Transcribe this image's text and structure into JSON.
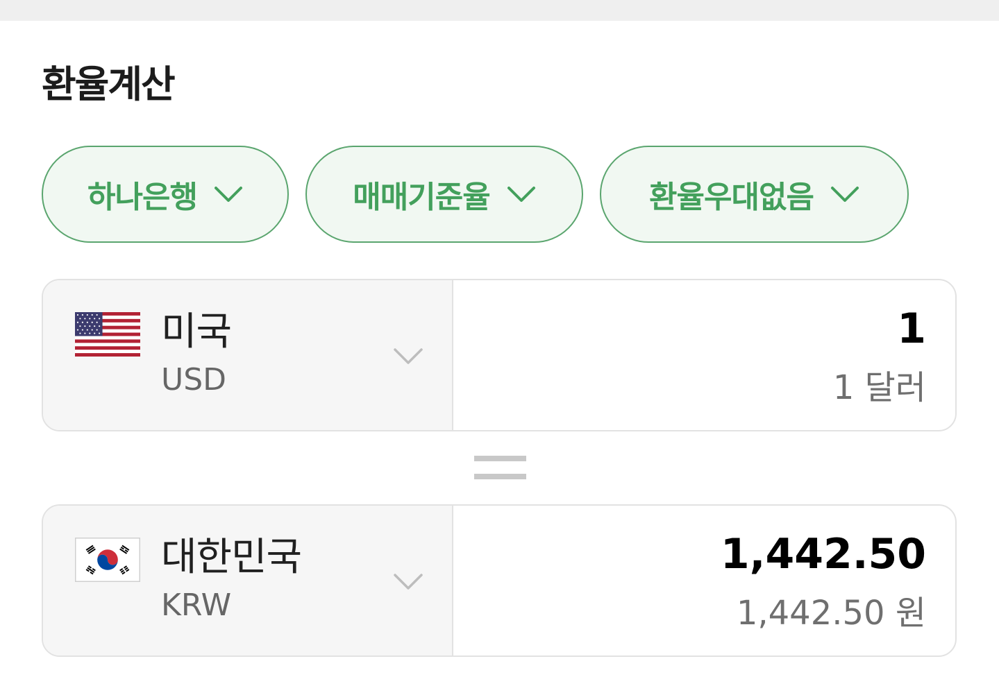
{
  "header": {
    "title": "환율계산"
  },
  "filters": [
    {
      "label": "하나은행",
      "icon": "chevron-down-icon"
    },
    {
      "label": "매매기준율",
      "icon": "chevron-down-icon"
    },
    {
      "label": "환율우대없음",
      "icon": "chevron-down-icon"
    }
  ],
  "from": {
    "country": "미국",
    "code": "USD",
    "flag": "us-flag-icon",
    "amount": "1",
    "amount_reading": "1 달러"
  },
  "equals_icon": "equals-icon",
  "to": {
    "country": "대한민국",
    "code": "KRW",
    "flag": "kr-flag-icon",
    "amount": "1,442.50",
    "amount_reading": "1,442.50 원"
  },
  "colors": {
    "accent": "#43a05c",
    "pill_border": "#5aa56e",
    "pill_bg": "#f1f8f2",
    "selector_bg": "#f6f6f6",
    "card_border": "#e2e2e2"
  }
}
